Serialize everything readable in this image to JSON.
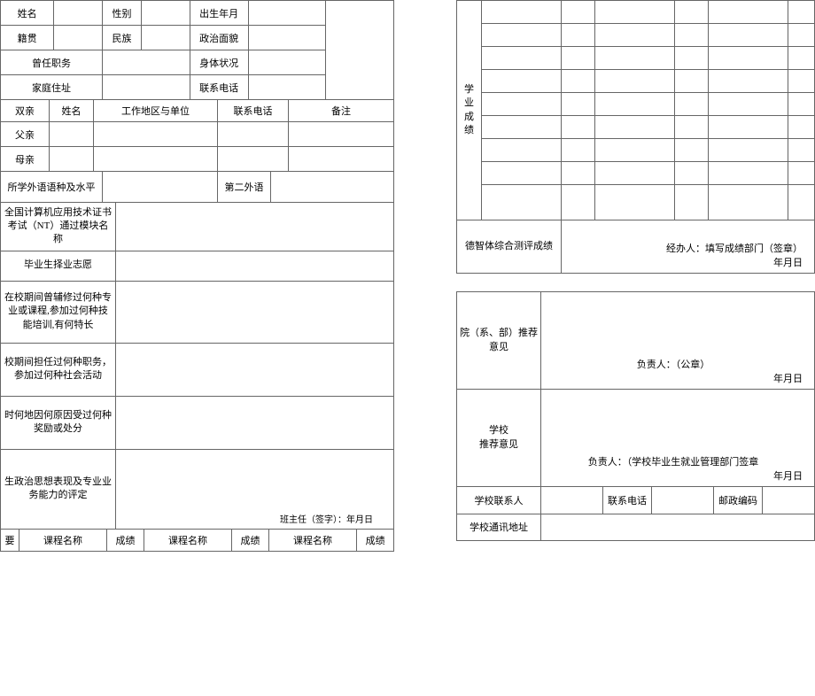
{
  "left": {
    "row1": {
      "name": "姓名",
      "gender": "性别",
      "birth": "出生年月"
    },
    "row2": {
      "origin": "籍贯",
      "ethnic": "民族",
      "political": "政治面貌"
    },
    "row3": {
      "position": "曾任职务",
      "health": "身体状况"
    },
    "row4": {
      "address": "家庭住址",
      "phone": "联系电话"
    },
    "parents": {
      "header": "双亲",
      "name": "姓名",
      "workplace": "工作地区与单位",
      "phone": "联系电话",
      "remark": "备注",
      "father": "父亲",
      "mother": "母亲"
    },
    "foreign": {
      "label": "所学外语语种及水平",
      "second": "第二外语"
    },
    "nit": "全国计算机应用技术证书考试（NT）通过模块名称",
    "career": "毕业生择业志愿",
    "training": "在校期间曾辅修过何种专业或课程,参加过何种技能培训,有何特长",
    "activity": "校期间担任过何种职务，参加过何种社会活动",
    "award": "时何地因何原因受过何种奖励或处分",
    "eval": "生政治思想表现及专业业务能力的评定",
    "teacher_sig": "班主任（签字）：年月日",
    "grades_header": {
      "brief": "要",
      "course": "课程名称",
      "score": "成绩"
    }
  },
  "right": {
    "academic": "学业成绩",
    "moral": "德智体综合测评成绩",
    "handler": "经办人：填写成绩部门（签章）",
    "date": "年月日",
    "dept_rec": "院（系、部）推荐意见",
    "dept_sig": "负责人：（公章）",
    "school_rec_l1": "学校",
    "school_rec_l2": "推荐意见",
    "school_sig": "负责人：（学校毕业生就业管理部门签章",
    "contact_person": "学校联系人",
    "contact_phone": "联系电话",
    "postal": "邮政编码",
    "mail_addr": "学校通讯地址"
  }
}
